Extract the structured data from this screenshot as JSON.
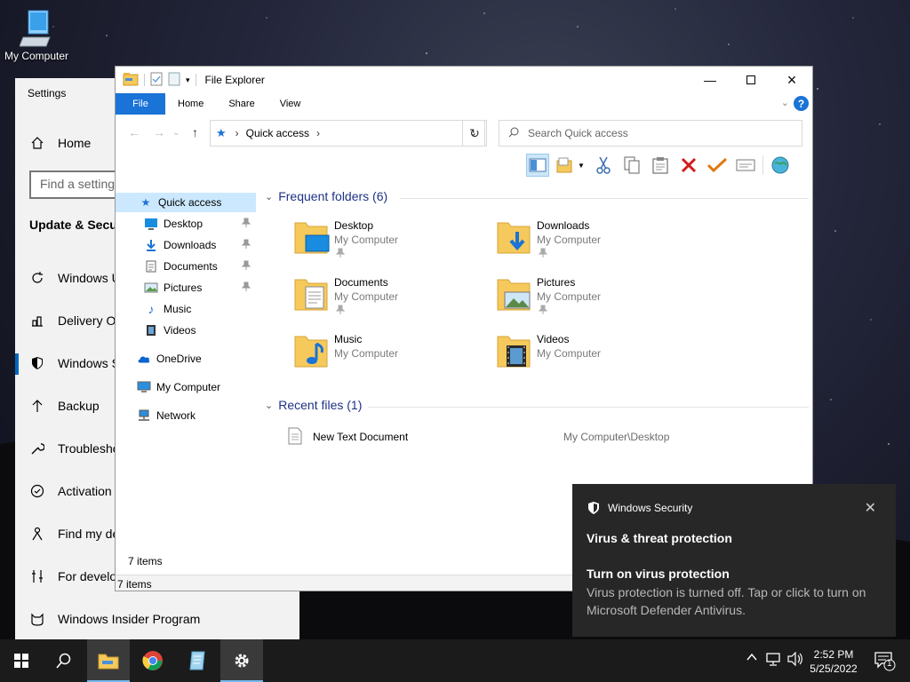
{
  "desktop": {
    "icon_label": "My Computer"
  },
  "settings": {
    "title": "Settings",
    "home": "Home",
    "search_placeholder": "Find a setting",
    "section": "Update & Security",
    "items": [
      "Windows Update",
      "Delivery Optimization",
      "Windows Security",
      "Backup",
      "Troubleshoot",
      "Activation",
      "Find my device",
      "For developers",
      "Windows Insider Program"
    ]
  },
  "explorer": {
    "title": "File Explorer",
    "tabs": [
      "File",
      "Home",
      "Share",
      "View"
    ],
    "address": "Quick access",
    "search_placeholder": "Search Quick access",
    "nav": {
      "quick_access": "Quick access",
      "desktop": "Desktop",
      "downloads": "Downloads",
      "documents": "Documents",
      "pictures": "Pictures",
      "music": "Music",
      "videos": "Videos",
      "onedrive": "OneDrive",
      "my_computer": "My Computer",
      "network": "Network"
    },
    "frequent_header": "Frequent folders (6)",
    "folders": [
      {
        "name": "Desktop",
        "location": "My Computer",
        "icon": "desktop-folder-icon",
        "pinned": true
      },
      {
        "name": "Downloads",
        "location": "My Computer",
        "icon": "downloads-folder-icon",
        "pinned": true
      },
      {
        "name": "Documents",
        "location": "My Computer",
        "icon": "documents-folder-icon",
        "pinned": true
      },
      {
        "name": "Pictures",
        "location": "My Computer",
        "icon": "pictures-folder-icon",
        "pinned": true
      },
      {
        "name": "Music",
        "location": "My Computer",
        "icon": "music-folder-icon",
        "pinned": false
      },
      {
        "name": "Videos",
        "location": "My Computer",
        "icon": "videos-folder-icon",
        "pinned": false
      }
    ],
    "recent_header": "Recent files (1)",
    "recent": [
      {
        "name": "New Text Document",
        "path": "My Computer\\Desktop"
      }
    ],
    "item_count": "7 items",
    "status": "7 items"
  },
  "toast": {
    "app": "Windows Security",
    "heading": "Virus & threat protection",
    "title": "Turn on virus protection",
    "body": "Virus protection is turned off. Tap or click to turn on Microsoft Defender Antivirus."
  },
  "taskbar": {
    "time": "2:52 PM",
    "date": "5/25/2022",
    "notifications": "1"
  },
  "colors": {
    "accent": "#1a73d6",
    "toast_bg": "#272727",
    "taskbar_bg": "#1b1b1b",
    "folder": "#f5c95b"
  }
}
